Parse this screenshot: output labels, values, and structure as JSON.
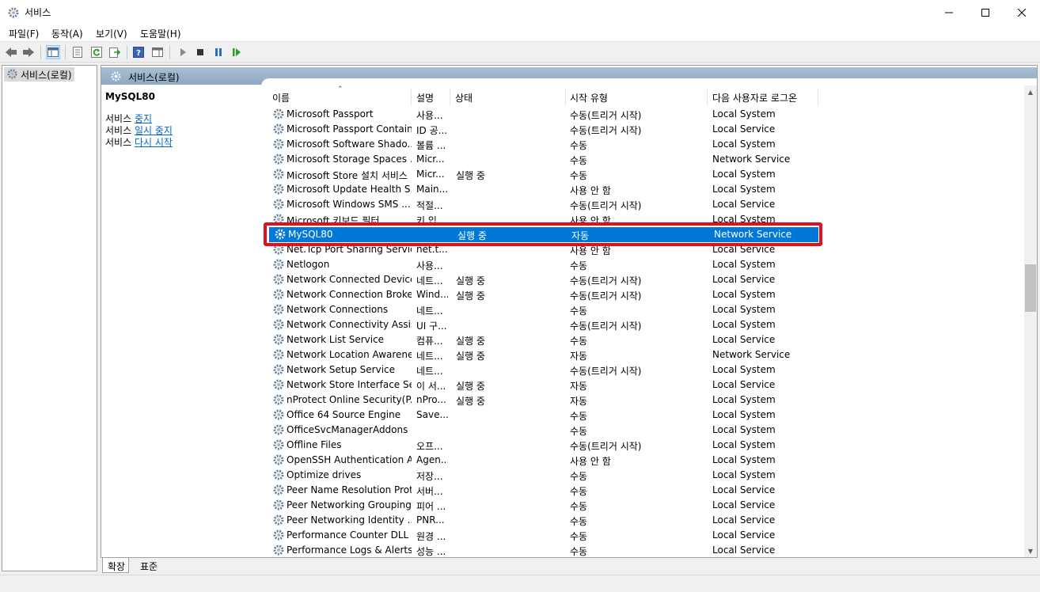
{
  "window": {
    "title": "서비스"
  },
  "menu": [
    "파일(F)",
    "동작(A)",
    "보기(V)",
    "도움말(H)"
  ],
  "tree": {
    "root": "서비스(로컬)"
  },
  "pane": {
    "header": "서비스(로컬)"
  },
  "description": {
    "service_name": "MySQL80",
    "actions": [
      {
        "prefix": "서비스 ",
        "link": "중지"
      },
      {
        "prefix": "서비스 ",
        "link": "일시 중지"
      },
      {
        "prefix": "서비스 ",
        "link": "다시 시작"
      }
    ]
  },
  "columns": {
    "name": "이름",
    "desc": "설명",
    "status": "상태",
    "startup": "시작 유형",
    "logon": "다음 사용자로 로그온"
  },
  "services": [
    {
      "name": "Microsoft Passport",
      "desc": "사용...",
      "status": "",
      "startup": "수동(트리거 시작)",
      "logon": "Local System"
    },
    {
      "name": "Microsoft Passport Container",
      "desc": "ID 공...",
      "status": "",
      "startup": "수동(트리거 시작)",
      "logon": "Local Service"
    },
    {
      "name": "Microsoft Software Shado...",
      "desc": "볼륨 ...",
      "status": "",
      "startup": "수동",
      "logon": "Local System"
    },
    {
      "name": "Microsoft Storage Spaces ...",
      "desc": "Micr...",
      "status": "",
      "startup": "수동",
      "logon": "Network Service"
    },
    {
      "name": "Microsoft Store 설치 서비스",
      "desc": "Micr...",
      "status": "실행 중",
      "startup": "수동",
      "logon": "Local System"
    },
    {
      "name": "Microsoft Update Health S...",
      "desc": "Main...",
      "status": "",
      "startup": "사용 안 함",
      "logon": "Local System"
    },
    {
      "name": "Microsoft Windows SMS ...",
      "desc": "적절...",
      "status": "",
      "startup": "수동(트리거 시작)",
      "logon": "Local Service"
    },
    {
      "name": "Microsoft 키보드 필터",
      "desc": "키 입...",
      "status": "",
      "startup": "사용 안 함",
      "logon": "Local System"
    },
    {
      "name": "MySQL80",
      "desc": "",
      "status": "실행 중",
      "startup": "자동",
      "logon": "Network Service",
      "selected": true
    },
    {
      "name": "Net.Tcp Port Sharing Service",
      "desc": "net.t...",
      "status": "",
      "startup": "사용 안 함",
      "logon": "Local Service"
    },
    {
      "name": "Netlogon",
      "desc": "사용...",
      "status": "",
      "startup": "수동",
      "logon": "Local System"
    },
    {
      "name": "Network Connected Device...",
      "desc": "네트...",
      "status": "실행 중",
      "startup": "수동(트리거 시작)",
      "logon": "Local Service"
    },
    {
      "name": "Network Connection Broker",
      "desc": "Wind...",
      "status": "실행 중",
      "startup": "수동(트리거 시작)",
      "logon": "Local System"
    },
    {
      "name": "Network Connections",
      "desc": "네트...",
      "status": "",
      "startup": "수동",
      "logon": "Local System"
    },
    {
      "name": "Network Connectivity Assis...",
      "desc": "UI 구...",
      "status": "",
      "startup": "수동(트리거 시작)",
      "logon": "Local System"
    },
    {
      "name": "Network List Service",
      "desc": "컴퓨...",
      "status": "실행 중",
      "startup": "수동",
      "logon": "Local Service"
    },
    {
      "name": "Network Location Awareness",
      "desc": "네트...",
      "status": "실행 중",
      "startup": "자동",
      "logon": "Network Service"
    },
    {
      "name": "Network Setup Service",
      "desc": "네트...",
      "status": "",
      "startup": "수동(트리거 시작)",
      "logon": "Local System"
    },
    {
      "name": "Network Store Interface Se...",
      "desc": "이 서...",
      "status": "실행 중",
      "startup": "자동",
      "logon": "Local Service"
    },
    {
      "name": "nProtect Online Security(P...",
      "desc": "nPro...",
      "status": "실행 중",
      "startup": "자동",
      "logon": "Local System"
    },
    {
      "name": "Office 64 Source Engine",
      "desc": "Save...",
      "status": "",
      "startup": "수동",
      "logon": "Local System"
    },
    {
      "name": "OfficeSvcManagerAddons",
      "desc": "",
      "status": "",
      "startup": "수동",
      "logon": "Local System"
    },
    {
      "name": "Offline Files",
      "desc": "오프...",
      "status": "",
      "startup": "수동(트리거 시작)",
      "logon": "Local System"
    },
    {
      "name": "OpenSSH Authentication A...",
      "desc": "Agen...",
      "status": "",
      "startup": "사용 안 함",
      "logon": "Local System"
    },
    {
      "name": "Optimize drives",
      "desc": "저장...",
      "status": "",
      "startup": "수동",
      "logon": "Local System"
    },
    {
      "name": "Peer Name Resolution Prot...",
      "desc": "서버...",
      "status": "",
      "startup": "수동",
      "logon": "Local Service"
    },
    {
      "name": "Peer Networking Grouping",
      "desc": "피어 ...",
      "status": "",
      "startup": "수동",
      "logon": "Local Service"
    },
    {
      "name": "Peer Networking Identity ...",
      "desc": "PNR...",
      "status": "",
      "startup": "수동",
      "logon": "Local Service"
    },
    {
      "name": "Performance Counter DLL ...",
      "desc": "원경 ...",
      "status": "",
      "startup": "수동",
      "logon": "Local Service"
    },
    {
      "name": "Performance Logs & Alerts",
      "desc": "성능 ...",
      "status": "",
      "startup": "수동",
      "logon": "Local Service"
    }
  ],
  "tabs": [
    "확장",
    "표준"
  ],
  "colors": {
    "selection": "#0078d7",
    "highlight_border": "#e0101e",
    "link": "#0066cc"
  }
}
